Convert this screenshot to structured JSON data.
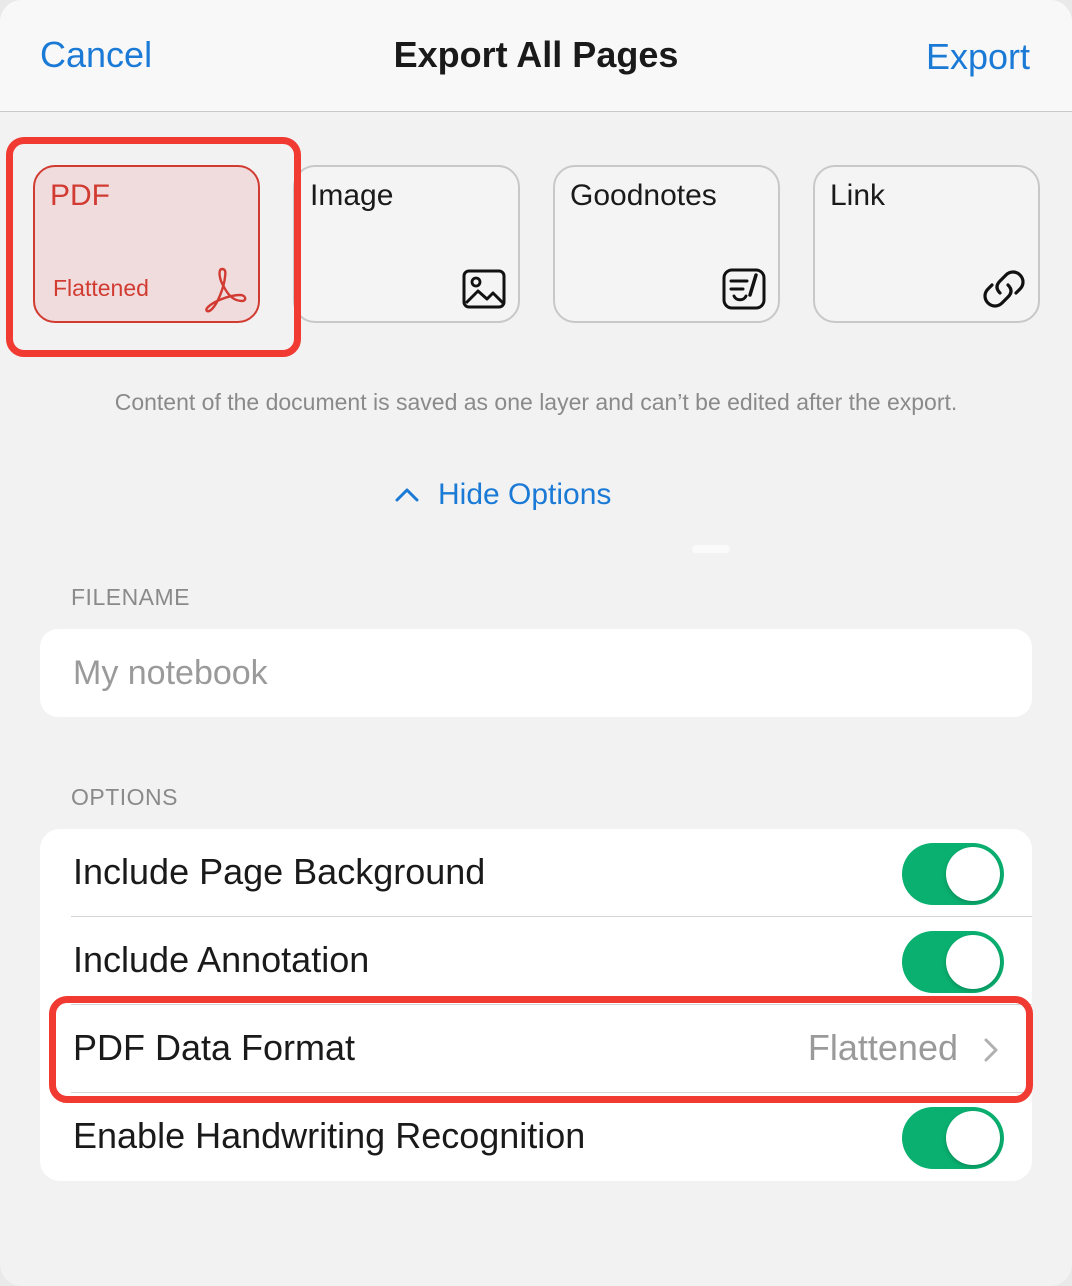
{
  "header": {
    "cancel_label": "Cancel",
    "title": "Export All Pages",
    "export_label": "Export"
  },
  "formats": [
    {
      "label": "PDF",
      "subtitle": "Flattened",
      "icon": "pdf-icon",
      "selected": true
    },
    {
      "label": "Image",
      "icon": "image-icon",
      "selected": false
    },
    {
      "label": "Goodnotes",
      "icon": "goodnotes-icon",
      "selected": false
    },
    {
      "label": "Link",
      "icon": "link-icon",
      "selected": false
    }
  ],
  "description": "Content of the document is saved as one layer and can’t be edited after the export.",
  "hide_options_label": "Hide Options",
  "filename": {
    "section_label": "FILENAME",
    "value": "",
    "placeholder": "My notebook"
  },
  "options": {
    "section_label": "OPTIONS",
    "items": [
      {
        "label": "Include Page Background",
        "type": "toggle",
        "on": true
      },
      {
        "label": "Include Annotation",
        "type": "toggle",
        "on": true
      },
      {
        "label": "PDF Data Format",
        "type": "disclosure",
        "value": "Flattened"
      },
      {
        "label": "Enable Handwriting Recognition",
        "type": "toggle",
        "on": true
      }
    ]
  },
  "colors": {
    "accent": "#1a7ad6",
    "selected": "#d13b32",
    "toggle_on": "#0ab070",
    "highlight": "#f03a32"
  }
}
